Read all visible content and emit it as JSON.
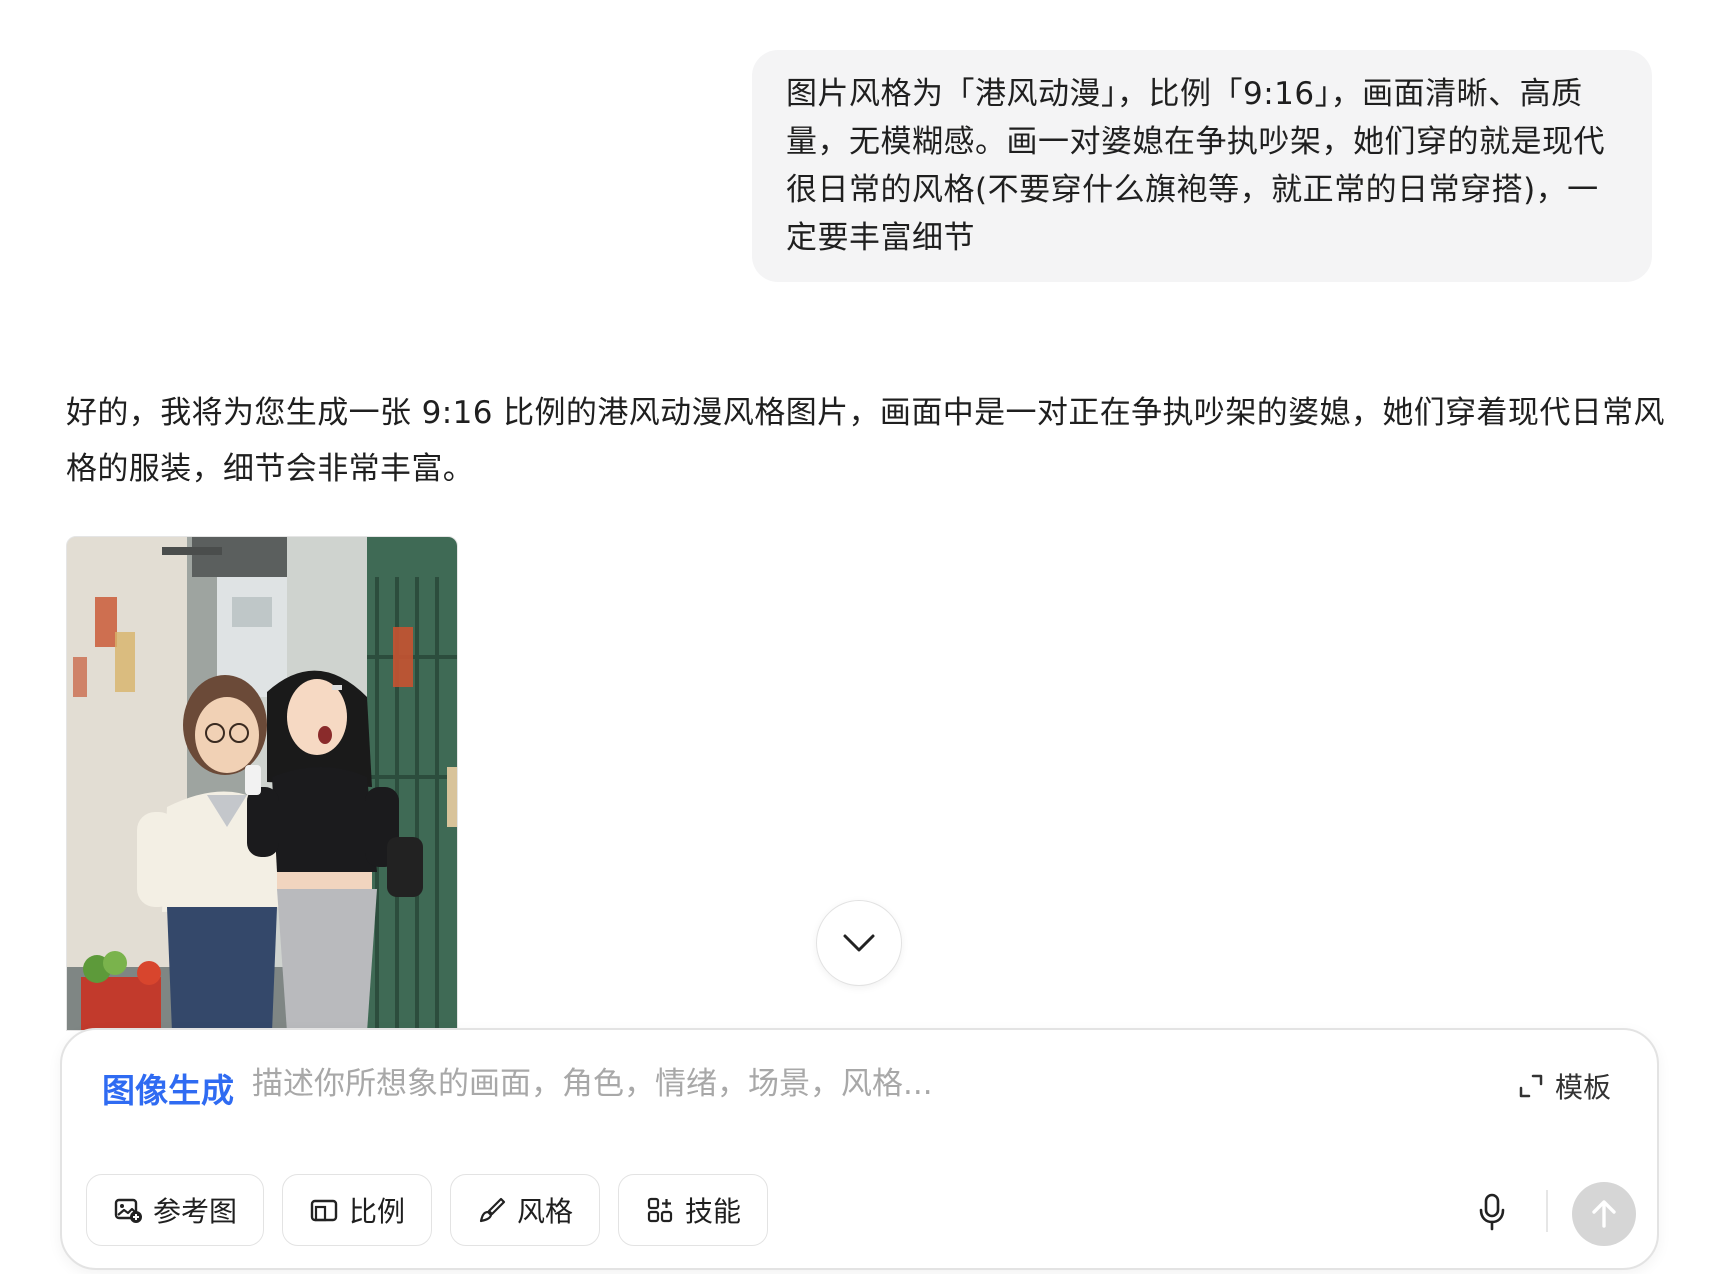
{
  "user_message": {
    "text": "图片风格为「港风动漫」，比例「9:16」，画面清晰、高质量，无模糊感。画一对婆媳在争执吵架，她们穿的就是现代很日常的风格(不要穿什么旗袍等，就正常的日常穿搭)，一定要丰富细节"
  },
  "assistant_message": {
    "text": "好的，我将为您生成一张 9:16 比例的港风动漫风格图片，画面中是一对正在争执吵架的婆媳，她们穿着现代日常风格的服装，细节会非常丰富。"
  },
  "generated_image": {
    "icon": "generated-image"
  },
  "scroll_button": {
    "icon": "chevron-down-icon"
  },
  "composer": {
    "mode_label": "图像生成",
    "placeholder": "描述你所想象的画面，角色，情绪，场景，风格...",
    "template_label": "模板",
    "tools": [
      {
        "label": "参考图",
        "icon": "image-add-icon"
      },
      {
        "label": "比例",
        "icon": "aspect-ratio-icon"
      },
      {
        "label": "风格",
        "icon": "brush-icon"
      },
      {
        "label": "技能",
        "icon": "apps-icon"
      }
    ],
    "colors": {
      "accent": "#2f6bf2",
      "send_disabled": "#d6d6d6"
    }
  }
}
